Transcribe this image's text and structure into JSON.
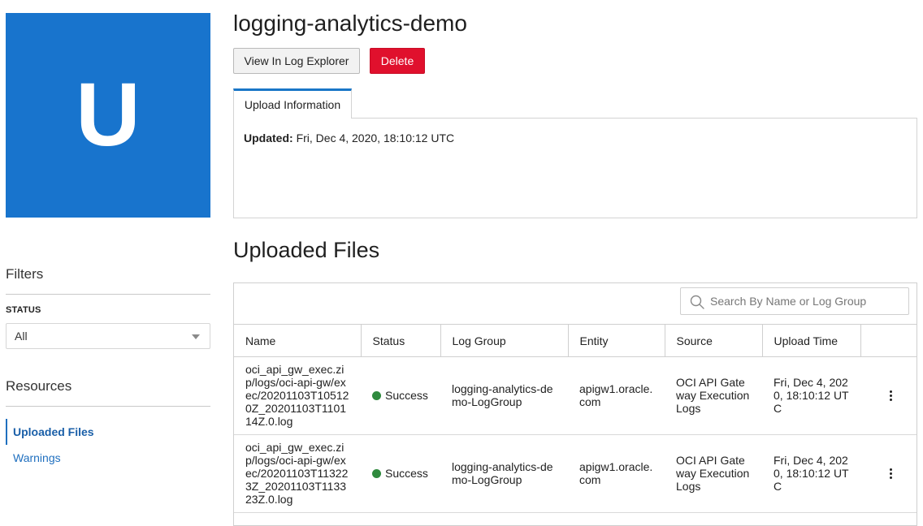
{
  "avatar": {
    "letter": "U",
    "color": "#1874cd"
  },
  "page": {
    "title": "logging-analytics-demo"
  },
  "actions": {
    "view_label": "View In Log Explorer",
    "delete_label": "Delete"
  },
  "tabs": [
    {
      "label": "Upload Information"
    }
  ],
  "upload_info": {
    "updated_label": "Updated:",
    "updated_value": "Fri, Dec 4, 2020, 18:10:12 UTC"
  },
  "filters": {
    "heading": "Filters",
    "status_label": "STATUS",
    "status_value": "All"
  },
  "resources": {
    "heading": "Resources",
    "items": [
      {
        "label": "Uploaded Files",
        "active": true
      },
      {
        "label": "Warnings",
        "active": false
      }
    ]
  },
  "uploaded_files": {
    "title": "Uploaded Files",
    "search_placeholder": "Search By Name or Log Group",
    "columns": [
      "Name",
      "Status",
      "Log Group",
      "Entity",
      "Source",
      "Upload Time"
    ],
    "rows": [
      {
        "name": "oci_api_gw_exec.zip/logs/oci-api-gw/exec/20201103T105120Z_20201103T110114Z.0.log",
        "status": "Success",
        "log_group": "logging-analytics-demo-LogGroup",
        "entity": "apigw1.oracle.com",
        "source": "OCI API Gateway Execution Logs",
        "upload_time": "Fri, Dec 4, 2020, 18:10:12 UTC"
      },
      {
        "name": "oci_api_gw_exec.zip/logs/oci-api-gw/exec/20201103T113223Z_20201103T113323Z.0.log",
        "status": "Success",
        "log_group": "logging-analytics-demo-LogGroup",
        "entity": "apigw1.oracle.com",
        "source": "OCI API Gateway Execution Logs",
        "upload_time": "Fri, Dec 4, 2020, 18:10:12 UTC"
      }
    ]
  },
  "colors": {
    "primary": "#1874cd",
    "danger": "#e0102d",
    "success": "#2f8a3e",
    "link": "#1f6fbf"
  }
}
